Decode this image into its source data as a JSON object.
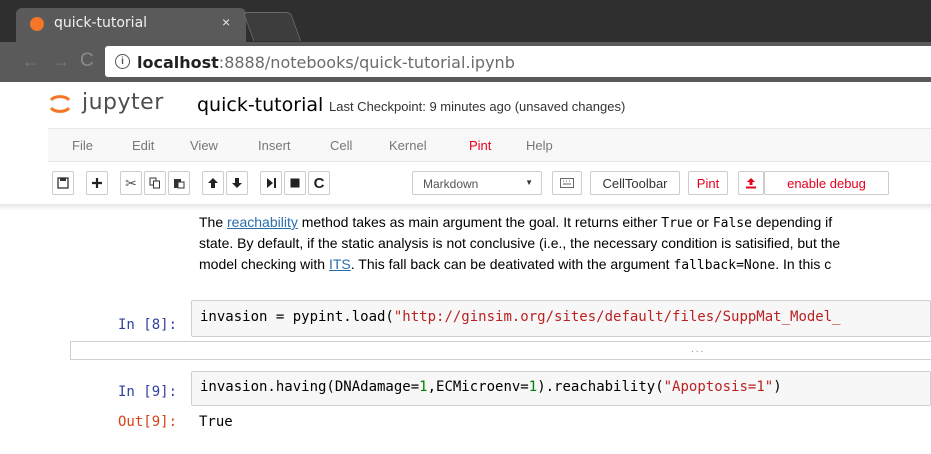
{
  "browser": {
    "tab_title": "quick-tutorial",
    "tab_close": "×",
    "url_host": "localhost",
    "url_path": ":8888/notebooks/quick-tutorial.ipynb",
    "info_glyph": "i"
  },
  "jupyter": {
    "logo_text": "jupyter",
    "notebook_name": "quick-tutorial",
    "checkpoint": "Last Checkpoint: 9 minutes ago (unsaved changes)"
  },
  "menu": [
    "File",
    "Edit",
    "View",
    "Insert",
    "Cell",
    "Kernel",
    "Pint",
    "Help"
  ],
  "toolbar": {
    "cell_type": "Markdown",
    "celltoolbar_label": "CellToolbar",
    "pint_label": "Pint",
    "enable_debug_label": "enable debug"
  },
  "markdown": {
    "line1_pre": "The ",
    "line1_link": "reachability",
    "line1_mid": " method takes as main argument the goal. It returns either ",
    "line1_true": "True",
    "line1_or": " or ",
    "line1_false": "False",
    "line1_post": " depending if",
    "line2": "state. By default, if the static analysis is not conclusive (i.e., the necessary condition is satisified, but the",
    "line3_pre": "model checking with ",
    "line3_link": "ITS",
    "line3_mid": ". This fall back can be deativated with the argument ",
    "line3_code": "fallback=None",
    "line3_post": ". In this c"
  },
  "cells": {
    "c8": {
      "prompt": "In [8]:",
      "code_a": "invasion = pypint.load(",
      "code_str": "\"http://ginsim.org/sites/default/files/SuppMat_Model_"
    },
    "c8_out_dots": "...",
    "c9": {
      "prompt": "In [9]:",
      "code_a": "invasion.having(DNAdamage=",
      "code_n1": "1",
      "code_b": ",ECMicroenv=",
      "code_n2": "1",
      "code_c": ").reachability(",
      "code_str": "\"Apoptosis=1\"",
      "code_d": ")"
    },
    "out9": {
      "prompt": "Out[9]:",
      "value": "True"
    }
  },
  "colors": {
    "pint_red": "#e6001e",
    "prompt_in": "#303f9f",
    "prompt_out": "#d84315",
    "string": "#ba2121",
    "number": "#008000",
    "link": "#296eaa"
  }
}
